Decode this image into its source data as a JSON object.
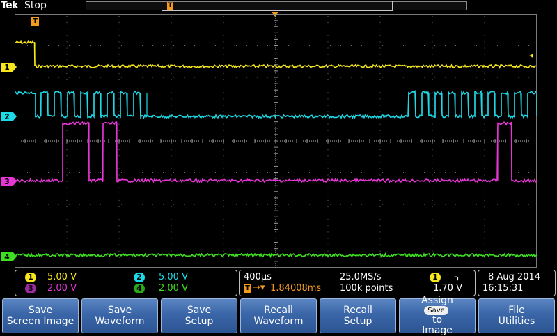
{
  "header": {
    "brand_tek": "Tek",
    "acq_state": "Stop",
    "trigger_marker": "T"
  },
  "channels": [
    {
      "id": "1",
      "color": "#f5e61d",
      "scale": "5.00 V"
    },
    {
      "id": "2",
      "color": "#1ed9e6",
      "scale": "5.00 V"
    },
    {
      "id": "3",
      "color": "#e636d6",
      "scale": "2.00 V"
    },
    {
      "id": "4",
      "color": "#3fe021",
      "scale": "2.00 V"
    }
  ],
  "timebase": {
    "horizontal_scale": "400µs",
    "sample_rate": "25.0MS/s",
    "trigger_delay": "1.84008ms",
    "record_length": "100k points"
  },
  "trigger": {
    "source": "1",
    "slope_icon": "falling-edge-icon",
    "level": "1.70 V",
    "color": "#f39a1e"
  },
  "datetime": {
    "date": "8 Aug 2014",
    "time": "16:15:31"
  },
  "softkeys": [
    {
      "line1": "Save",
      "line2": "Screen Image"
    },
    {
      "line1": "Save",
      "line2": "Waveform"
    },
    {
      "line1": "Save",
      "line2": "Setup"
    },
    {
      "line1": "Recall",
      "line2": "Waveform"
    },
    {
      "line1": "Recall",
      "line2": "Setup"
    },
    {
      "line1": "Assign",
      "pill": "Save",
      "line2": "to",
      "line3": "Image"
    },
    {
      "line1": "File",
      "line2": "Utilities"
    }
  ]
}
